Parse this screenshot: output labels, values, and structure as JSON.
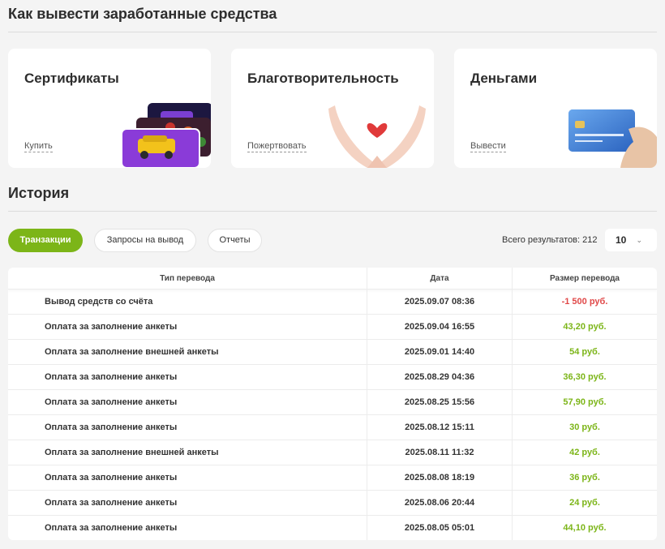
{
  "withdraw_section": {
    "title": "Как вывести заработанные средства"
  },
  "cards": [
    {
      "title": "Сертификаты",
      "link": "Купить"
    },
    {
      "title": "Благотворительность",
      "link": "Пожертвовать"
    },
    {
      "title": "Деньгами",
      "link": "Вывести"
    }
  ],
  "history": {
    "title": "История"
  },
  "tabs": [
    {
      "label": "Транзакции",
      "active": true
    },
    {
      "label": "Запросы на вывод",
      "active": false
    },
    {
      "label": "Отчеты",
      "active": false
    }
  ],
  "results": {
    "label": "Всего результатов: 212",
    "per_page": "10"
  },
  "table": {
    "headers": [
      "Тип перевода",
      "Дата",
      "Размер перевода"
    ],
    "rows": [
      {
        "type": "Вывод средств со счёта",
        "date": "2025.09.07 08:36",
        "amount": "-1 500 руб.",
        "negative": true
      },
      {
        "type": "Оплата за заполнение анкеты",
        "date": "2025.09.04 16:55",
        "amount": "43,20 руб.",
        "negative": false
      },
      {
        "type": "Оплата за заполнение внешней анкеты",
        "date": "2025.09.01 14:40",
        "amount": "54 руб.",
        "negative": false
      },
      {
        "type": "Оплата за заполнение анкеты",
        "date": "2025.08.29 04:36",
        "amount": "36,30 руб.",
        "negative": false
      },
      {
        "type": "Оплата за заполнение анкеты",
        "date": "2025.08.25 15:56",
        "amount": "57,90 руб.",
        "negative": false
      },
      {
        "type": "Оплата за заполнение анкеты",
        "date": "2025.08.12 15:11",
        "amount": "30 руб.",
        "negative": false
      },
      {
        "type": "Оплата за заполнение внешней анкеты",
        "date": "2025.08.11 11:32",
        "amount": "42 руб.",
        "negative": false
      },
      {
        "type": "Оплата за заполнение анкеты",
        "date": "2025.08.08 18:19",
        "amount": "36 руб.",
        "negative": false
      },
      {
        "type": "Оплата за заполнение анкеты",
        "date": "2025.08.06 20:44",
        "amount": "24 руб.",
        "negative": false
      },
      {
        "type": "Оплата за заполнение анкеты",
        "date": "2025.08.05 05:01",
        "amount": "44,10 руб.",
        "negative": false
      }
    ]
  },
  "colors": {
    "accent": "#7cb518",
    "negative": "#e04848",
    "background": "#f4f4f4"
  },
  "icons": {
    "per_page_dropdown": "chevron-down-icon"
  }
}
